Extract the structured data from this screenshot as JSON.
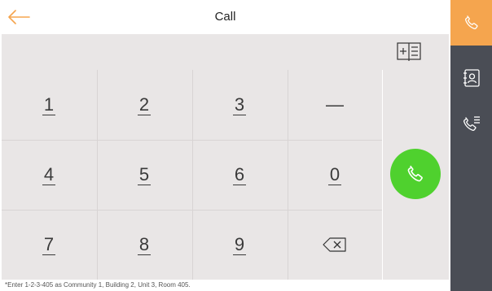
{
  "header": {
    "title": "Call",
    "back_icon": "back-arrow-icon"
  },
  "input_bar": {
    "value": "",
    "book_icon": "add-from-contacts-icon"
  },
  "keypad": {
    "keys": [
      {
        "label": "1"
      },
      {
        "label": "2"
      },
      {
        "label": "3"
      },
      {
        "label": "—"
      },
      {
        "label": "4"
      },
      {
        "label": "5"
      },
      {
        "label": "6"
      },
      {
        "label": "0"
      },
      {
        "label": "7"
      },
      {
        "label": "8"
      },
      {
        "label": "9"
      },
      {
        "label": "",
        "icon": "backspace-icon"
      }
    ]
  },
  "call_button": {
    "icon": "phone-icon",
    "color": "#4fd12e"
  },
  "hint": "*Enter 1-2-3-405 as Community 1, Building 2, Unit 3, Room 405.",
  "sidebar": {
    "items": [
      {
        "icon": "phone-icon",
        "active": true
      },
      {
        "icon": "contacts-icon",
        "active": false
      },
      {
        "icon": "call-log-icon",
        "active": false
      }
    ]
  },
  "colors": {
    "accent": "#f5a54e",
    "sidebar_bg": "#4a4d55",
    "panel_bg": "#e9e6e6",
    "call_green": "#4fd12e"
  }
}
